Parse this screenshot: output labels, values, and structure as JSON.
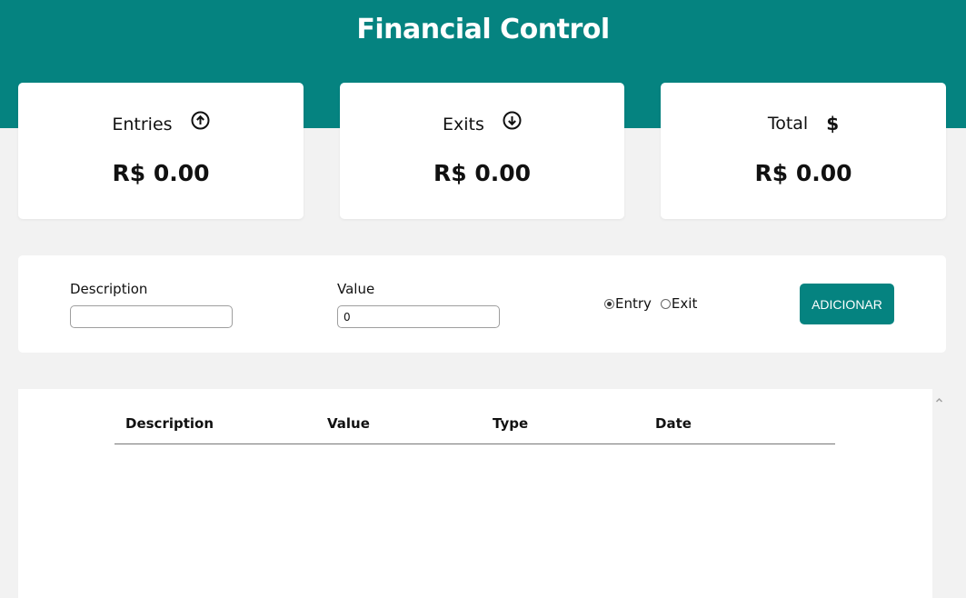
{
  "header": {
    "title": "Financial Control"
  },
  "colors": {
    "accent": "#058380",
    "background": "#f2f2f2",
    "card": "#ffffff"
  },
  "cards": [
    {
      "label": "Entries",
      "icon": "arrow-circle-up-icon",
      "value": "R$ 0.00"
    },
    {
      "label": "Exits",
      "icon": "arrow-circle-down-icon",
      "value": "R$ 0.00"
    },
    {
      "label": "Total",
      "icon": "dollar-icon",
      "value": "R$ 0.00"
    }
  ],
  "form": {
    "description_label": "Description",
    "description_value": "",
    "value_label": "Value",
    "value_value": "0",
    "type_options": [
      {
        "label": "Entry",
        "checked": true
      },
      {
        "label": "Exit",
        "checked": false
      }
    ],
    "submit_label": "ADICIONAR"
  },
  "table": {
    "columns": [
      "Description",
      "Value",
      "Type",
      "Date"
    ],
    "rows": []
  }
}
